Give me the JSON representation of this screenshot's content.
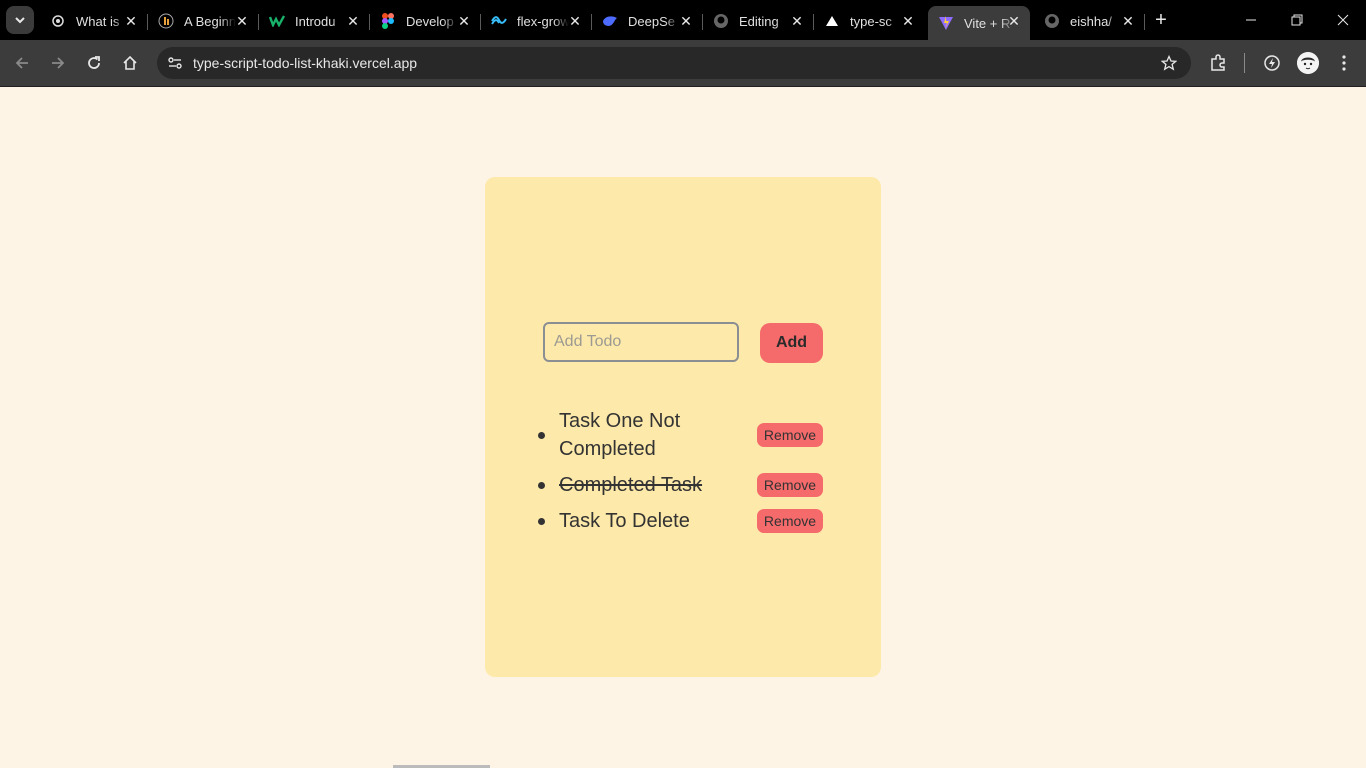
{
  "browser": {
    "tabs": [
      {
        "title": "What is",
        "icon": "openai-icon"
      },
      {
        "title": "A Beginn",
        "icon": "freecodecamp-icon"
      },
      {
        "title": "Introdu",
        "icon": "webflow-icon"
      },
      {
        "title": "Develop",
        "icon": "figma-icon"
      },
      {
        "title": "flex-grow",
        "icon": "tailwind-icon"
      },
      {
        "title": "DeepSe",
        "icon": "deepseek-icon"
      },
      {
        "title": "Editing",
        "icon": "github-icon"
      },
      {
        "title": "type-sc",
        "icon": "vercel-icon"
      },
      {
        "title": "Vite + R",
        "icon": "vite-icon",
        "active": true
      },
      {
        "title": "eishha/",
        "icon": "github-icon"
      }
    ],
    "url": "type-script-todo-list-khaki.vercel.app",
    "colors": {
      "tabbar": "#000000",
      "toolbar": "#3c3c3c",
      "omnibox": "#282828"
    }
  },
  "app": {
    "input": {
      "placeholder": "Add Todo",
      "value": ""
    },
    "add_label": "Add",
    "todos": [
      {
        "text": "Task One Not Completed",
        "completed": false,
        "remove_label": "Remove"
      },
      {
        "text": "Completed Task",
        "completed": true,
        "remove_label": "Remove"
      },
      {
        "text": "Task To Delete",
        "completed": false,
        "remove_label": "Remove"
      }
    ],
    "colors": {
      "page_bg": "#fdf4e6",
      "card_bg": "#fde9a9",
      "button": "#f56a6a"
    }
  }
}
